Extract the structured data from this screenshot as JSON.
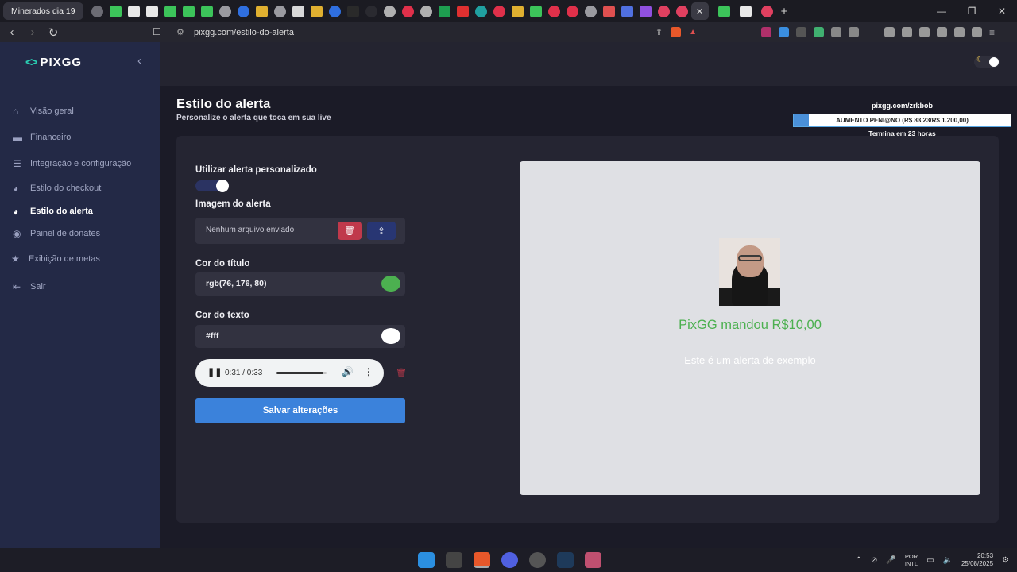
{
  "browser": {
    "active_tab_title": "Minerados dia 19",
    "close_tab": "✕",
    "new_tab": "+",
    "url": "pixgg.com/estilo-do-alerta"
  },
  "sidebar": {
    "logo": "PIXGG",
    "collapse_icon": "‹",
    "items": [
      {
        "label": "Visão geral",
        "icon": "home-icon"
      },
      {
        "label": "Financeiro",
        "icon": "wallet-icon"
      },
      {
        "label": "Integração e configuração",
        "icon": "config-icon"
      },
      {
        "label": "Estilo do checkout",
        "icon": "palette-icon"
      },
      {
        "label": "Estilo do alerta",
        "icon": "palette-icon",
        "active": true
      },
      {
        "label": "Painel de donates",
        "icon": "coins-icon"
      },
      {
        "label": "Exibição de metas",
        "icon": "star-icon"
      },
      {
        "label": "Sair",
        "icon": "logout-icon"
      }
    ]
  },
  "page": {
    "title": "Estilo do alerta",
    "subtitle": "Personalize o alerta que toca em sua live"
  },
  "goal": {
    "url": "pixgg.com/zrkbob",
    "label": "AUMENTO PENI@NO (R$ 83,23/R$ 1.200,00)",
    "progress_fraction": 0.069,
    "ends": "Termina em 23 horas"
  },
  "form": {
    "custom_alert_label": "Utilizar alerta personalizado",
    "custom_alert_enabled": true,
    "image_label": "Imagem do alerta",
    "image_status": "Nenhum arquivo enviado",
    "title_color_label": "Cor do título",
    "title_color_value": "rgb(76, 176, 80)",
    "title_color_hex": "#4cb050",
    "text_color_label": "Cor do texto",
    "text_color_value": "#fff",
    "text_color_hex": "#ffffff",
    "save_label": "Salvar alterações"
  },
  "audio": {
    "time": "0:31 / 0:33",
    "progress_fraction": 0.94
  },
  "preview": {
    "title": "PixGG mandou R$10,00",
    "text": "Este é um alerta de exemplo"
  },
  "taskbar": {
    "lang_line1": "POR",
    "lang_line2": "INTL",
    "time": "20:53",
    "date": "25/08/2025"
  },
  "colors": {
    "accent": "#3b82db",
    "sidebar_bg": "#232946",
    "danger": "#c0394b",
    "logo_mark": "#2ad1b4"
  }
}
